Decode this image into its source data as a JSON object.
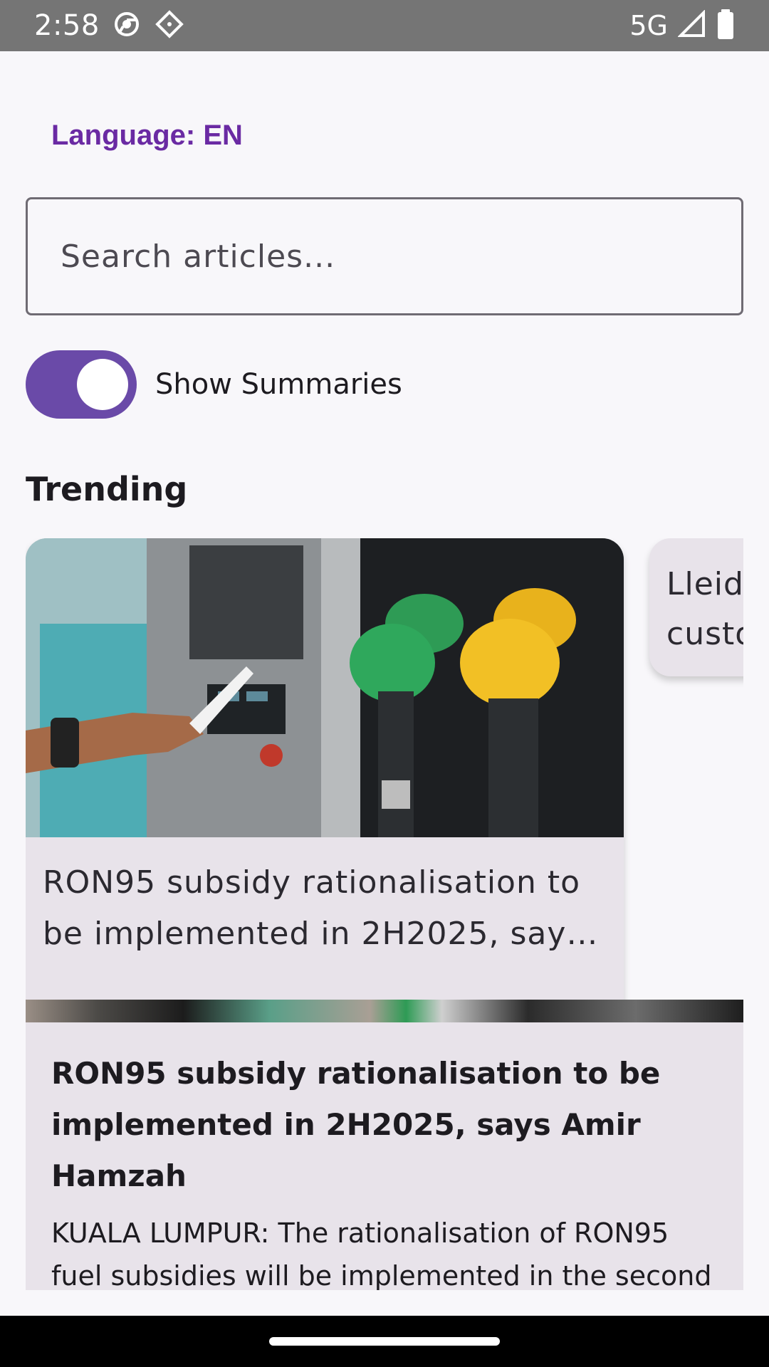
{
  "status_bar": {
    "time": "2:58",
    "network": "5G",
    "icons": [
      "chrome-icon",
      "diamond-app-icon",
      "signal-icon",
      "battery-icon"
    ]
  },
  "header": {
    "language_label": "Language: EN"
  },
  "search": {
    "placeholder": "Search articles..."
  },
  "summaries_toggle": {
    "label": "Show Summaries",
    "checked": true
  },
  "trending": {
    "title": "Trending",
    "cards": [
      {
        "title": "RON95 subsidy rationalisation to be implemented in 2H2025, says …",
        "image": "fuel-pump-nozzles-photo"
      },
      {
        "title": "Lleid custo"
      }
    ]
  },
  "articles": [
    {
      "title": "RON95 subsidy rationalisation to be implemented in 2H2025, says Amir Hamzah",
      "summary": "KUALA LUMPUR: The rationalisation of RON95 fuel subsidies will be implemented in the second"
    }
  ],
  "colors": {
    "accent": "#6a4aa8",
    "language_text": "#6a2aa3",
    "card_bg": "#e8e3ea",
    "page_bg": "#f8f7fa"
  }
}
